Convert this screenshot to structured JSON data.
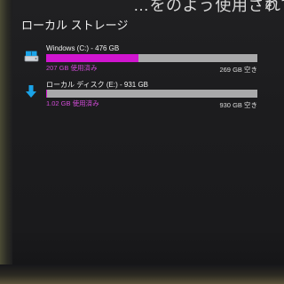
{
  "header": {
    "cutoff_title": "…をのよう使用されているかを表示する",
    "section_title": "ローカル ストレージ"
  },
  "drives": [
    {
      "name": "Windows (C:) - 476 GB",
      "used_label": "207 GB 使用済み",
      "free_label": "269 GB 空き",
      "used_fraction": 0.435,
      "icon": "windows-drive-icon",
      "bar_color": "#d015cf"
    },
    {
      "name": "ローカル ディスク (E:) - 931 GB",
      "used_label": "1.02 GB 使用済み",
      "free_label": "930 GB 空き",
      "used_fraction": 0.0011,
      "icon": "download-arrow-icon",
      "bar_color": "#d015cf"
    }
  ],
  "colors": {
    "accent": "#d015cf",
    "bar_track": "#a9a9aa",
    "background": "#1c1c1e",
    "icon_blue": "#1aa3e8"
  }
}
